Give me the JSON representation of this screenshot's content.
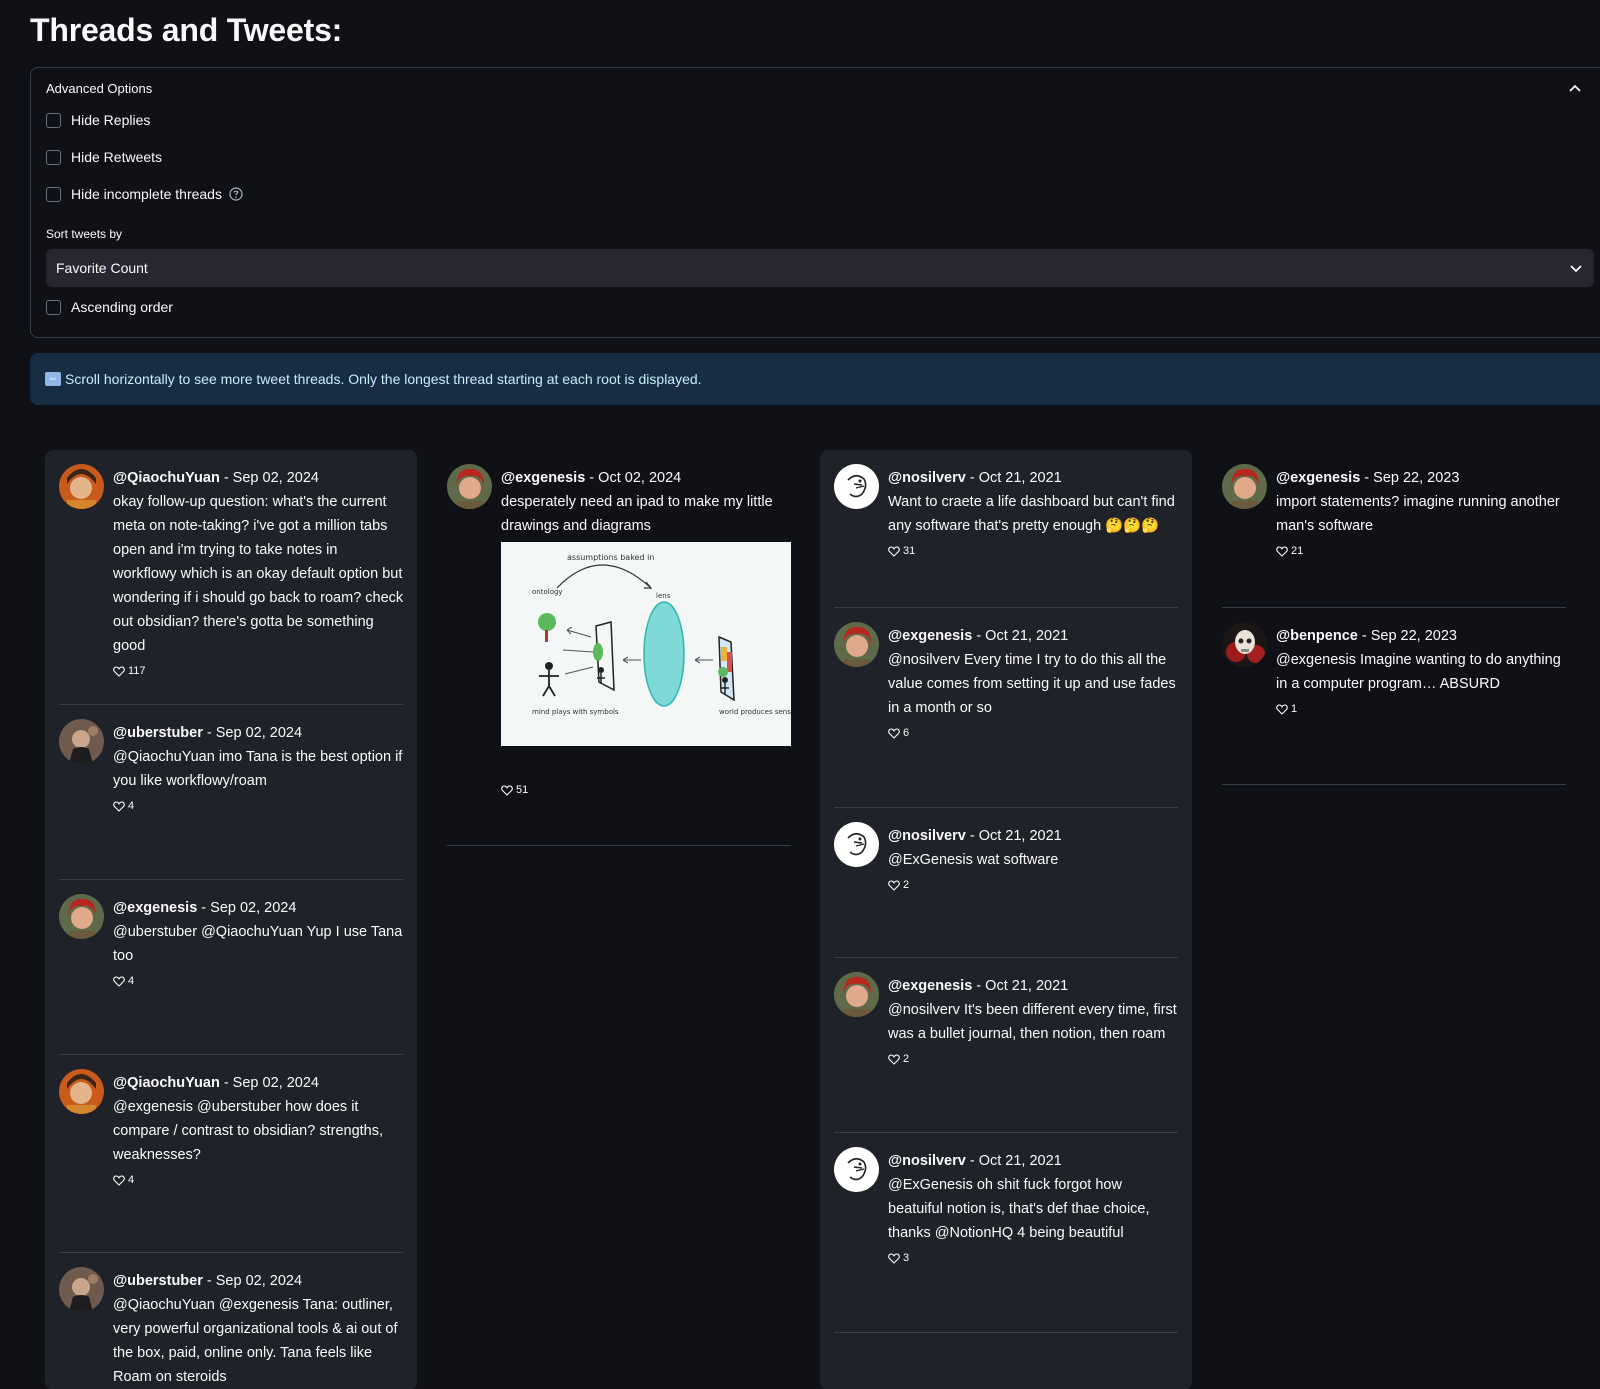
{
  "page": {
    "title": "Threads and Tweets:"
  },
  "options": {
    "header": "Advanced Options",
    "hide_replies": "Hide Replies",
    "hide_retweets": "Hide Retweets",
    "hide_incomplete": "Hide incomplete threads",
    "sort_label": "Sort tweets by",
    "sort_value": "Favorite Count",
    "ascending": "Ascending order"
  },
  "info": {
    "text": "Scroll horizontally to see more tweet threads. Only the longest thread starting at each root is displayed."
  },
  "colors": {
    "background": "#0f1116",
    "panel": "#1f2229",
    "info_bg": "#172d43",
    "info_text": "#c7ebff"
  },
  "columns": [
    {
      "tweets": [
        {
          "handle": "@QiaochuYuan",
          "date": " - Sep 02, 2024",
          "text": "okay follow-up question: what's the current meta on note-taking? i've got a million tabs open and i'm trying to take notes in workflowy which is an okay default option but wondering if i should go back to roam? check out obsidian? there's gotta be something good",
          "likes": "117",
          "avatar": "qiaochu"
        },
        {
          "handle": "@uberstuber",
          "date": " - Sep 02, 2024",
          "text": "@QiaochuYuan imo Tana is the best option if you like workflowy/roam",
          "likes": "4",
          "avatar": "uberstuber"
        },
        {
          "handle": "@exgenesis",
          "date": " - Sep 02, 2024",
          "text": "@uberstuber @QiaochuYuan Yup I use Tana too",
          "likes": "4",
          "avatar": "exgenesis"
        },
        {
          "handle": "@QiaochuYuan",
          "date": " - Sep 02, 2024",
          "text": "@exgenesis @uberstuber how does it compare / contrast to obsidian? strengths, weaknesses?",
          "likes": "4",
          "avatar": "qiaochu"
        },
        {
          "handle": "@uberstuber",
          "date": " - Sep 02, 2024",
          "text": "@QiaochuYuan @exgenesis Tana: outliner, very powerful organizational tools & ai out of the box, paid, online only. Tana feels like Roam on steroids",
          "likes": "",
          "avatar": "uberstuber"
        }
      ]
    },
    {
      "tweets": [
        {
          "handle": "@exgenesis",
          "date": " - Oct 02, 2024",
          "text": "desperately need an ipad to make my little drawings and diagrams",
          "likes": "51",
          "avatar": "exgenesis",
          "image": {
            "top_label": "assumptions baked in",
            "ontology": "ontology",
            "lens": "lens",
            "mind": "mind plays with symbols",
            "world": "world produces sense data"
          }
        }
      ]
    },
    {
      "tweets": [
        {
          "handle": "@nosilverv",
          "date": " - Oct 21, 2021",
          "text": "Want to craete a life dashboard but can't find any software that's pretty enough 🤔🤔🤔",
          "likes": "31",
          "avatar": "nosilverv"
        },
        {
          "handle": "@exgenesis",
          "date": " - Oct 21, 2021",
          "text": "@nosilverv Every time I try to do this all the value comes from setting it up and use fades in a month or so",
          "likes": "6",
          "avatar": "exgenesis"
        },
        {
          "handle": "@nosilverv",
          "date": " - Oct 21, 2021",
          "text": "@ExGenesis wat software",
          "likes": "2",
          "avatar": "nosilverv"
        },
        {
          "handle": "@exgenesis",
          "date": " - Oct 21, 2021",
          "text": "@nosilverv It's been different every time, first was a bullet journal, then notion, then roam",
          "likes": "2",
          "avatar": "exgenesis"
        },
        {
          "handle": "@nosilverv",
          "date": " - Oct 21, 2021",
          "text": "@ExGenesis oh shit fuck forgot how beatuiful notion is, that's def thae choice, thanks @NotionHQ 4 being beautiful",
          "likes": "3",
          "avatar": "nosilverv"
        }
      ]
    },
    {
      "tweets": [
        {
          "handle": "@exgenesis",
          "date": " - Sep 22, 2023",
          "text": "import statements? imagine running another man's software",
          "likes": "21",
          "avatar": "exgenesis"
        },
        {
          "handle": "@benpence",
          "date": " - Sep 22, 2023",
          "text": "@exgenesis Imagine wanting to do anything in a computer program… ABSURD",
          "likes": "1",
          "avatar": "benpence"
        }
      ]
    }
  ]
}
